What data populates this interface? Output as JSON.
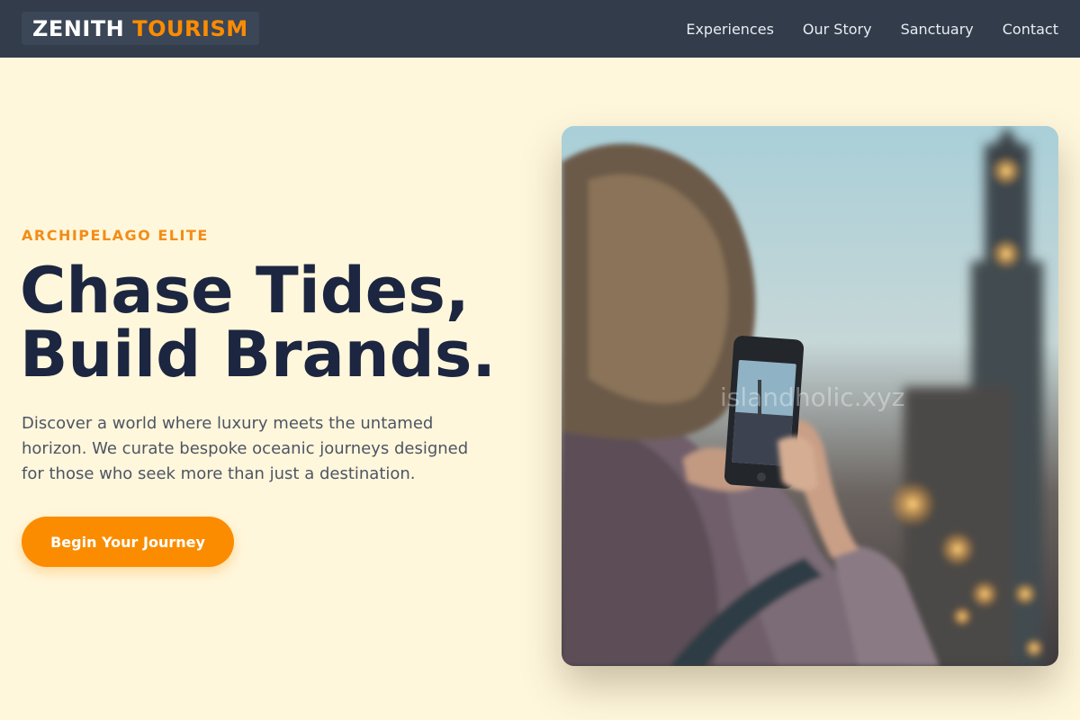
{
  "brand": {
    "name_part1": "ZENITH",
    "name_part2": "TOURISM"
  },
  "nav": {
    "links": [
      {
        "label": "Experiences"
      },
      {
        "label": "Our Story"
      },
      {
        "label": "Sanctuary"
      },
      {
        "label": "Contact"
      }
    ]
  },
  "hero": {
    "eyebrow": "ARCHIPELAGO ELITE",
    "headline_line1": "Chase Tides,",
    "headline_line2": "Build Brands.",
    "description": "Discover a world where luxury meets the untamed horizon. We curate bespoke oceanic journeys designed for those who seek more than just a destination.",
    "cta_label": "Begin Your Journey"
  },
  "image": {
    "watermark": "islandholic.xyz",
    "subject": "person-photographing-clock-tower-with-phone"
  },
  "colors": {
    "accent": "#fb8c00",
    "navbar": "#323c4b",
    "background": "#fff7dc",
    "headline": "#1c2640"
  }
}
